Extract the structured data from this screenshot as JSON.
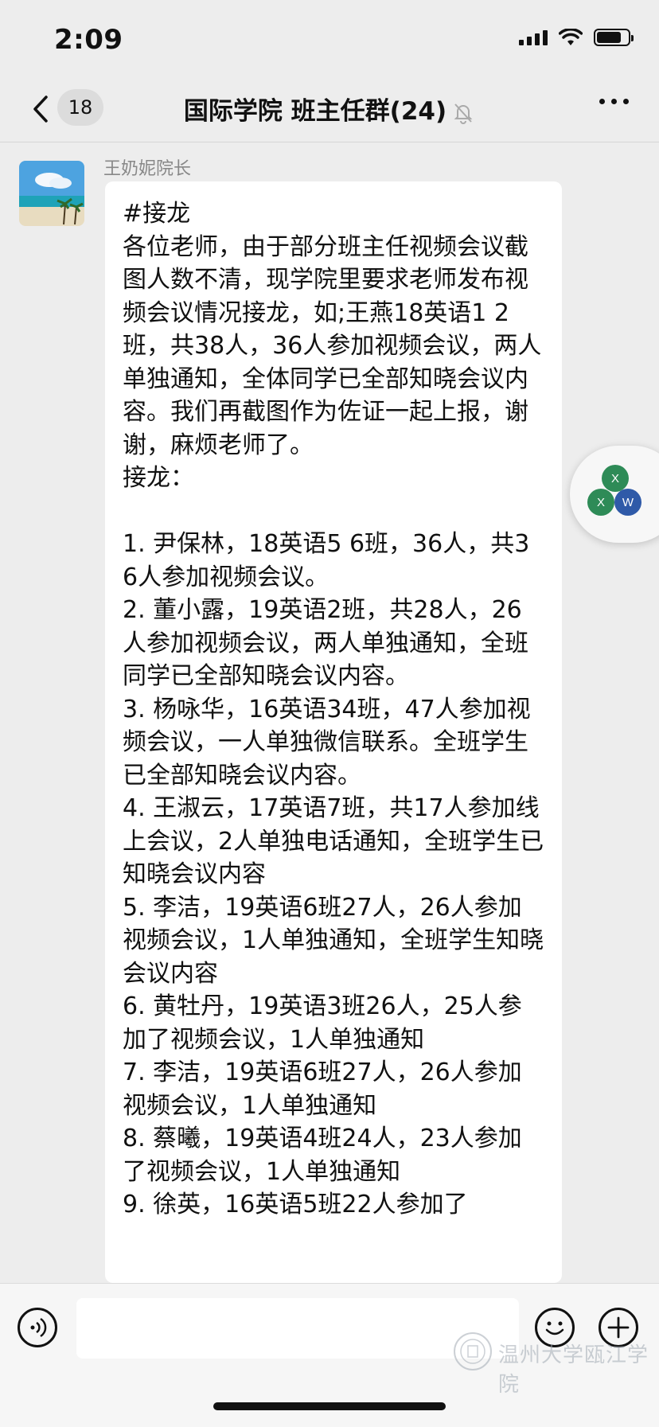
{
  "status_bar": {
    "time": "2:09"
  },
  "nav": {
    "unread_count": "18",
    "title": "国际学院  班主任群(24)"
  },
  "message": {
    "sender": "王奶妮院长",
    "lines": [
      "#接龙",
      "各位老师，由于部分班主任视频会议截图人数不清，现学院里要求老师发布视频会议情况接龙，如;王燕18英语1 2班，共38人，36人参加视频会议，两人单独通知，全体同学已全部知晓会议内容。我们再截图作为佐证一起上报，谢谢，麻烦老师了。",
      "接龙：",
      "",
      "1. 尹保林，18英语5 6班，36人，共36人参加视频会议。",
      "2. 董小露，19英语2班，共28人，26人参加视频会议，两人单独通知，全班同学已全部知晓会议内容。",
      "3. 杨咏华，16英语34班，47人参加视频会议，一人单独微信联系。全班学生已全部知晓会议内容。",
      "4. 王淑云，17英语7班，共17人参加线上会议，2人单独电话通知，全班学生已知晓会议内容",
      "5. 李洁，19英语6班27人，26人参加视频会议，1人单独通知，全班学生知晓会议内容",
      "6. 黄牡丹，19英语3班26人，25人参加了视频会议，1人单独通知",
      "7. 李洁，19英语6班27人，26人参加视频会议，1人单独通知",
      "8. 蔡曦，19英语4班24人，23人参加了视频会议，1人单独通知",
      "9. 徐英，16英语5班22人参加了"
    ]
  },
  "floating_widget": {
    "labels": [
      "X",
      "X",
      "W"
    ],
    "colors": [
      "#2e8b57",
      "#2e8b57",
      "#2f5aa8"
    ]
  },
  "input": {
    "value": "",
    "placeholder": ""
  },
  "watermark": {
    "text": "温州大学瓯江学院"
  }
}
